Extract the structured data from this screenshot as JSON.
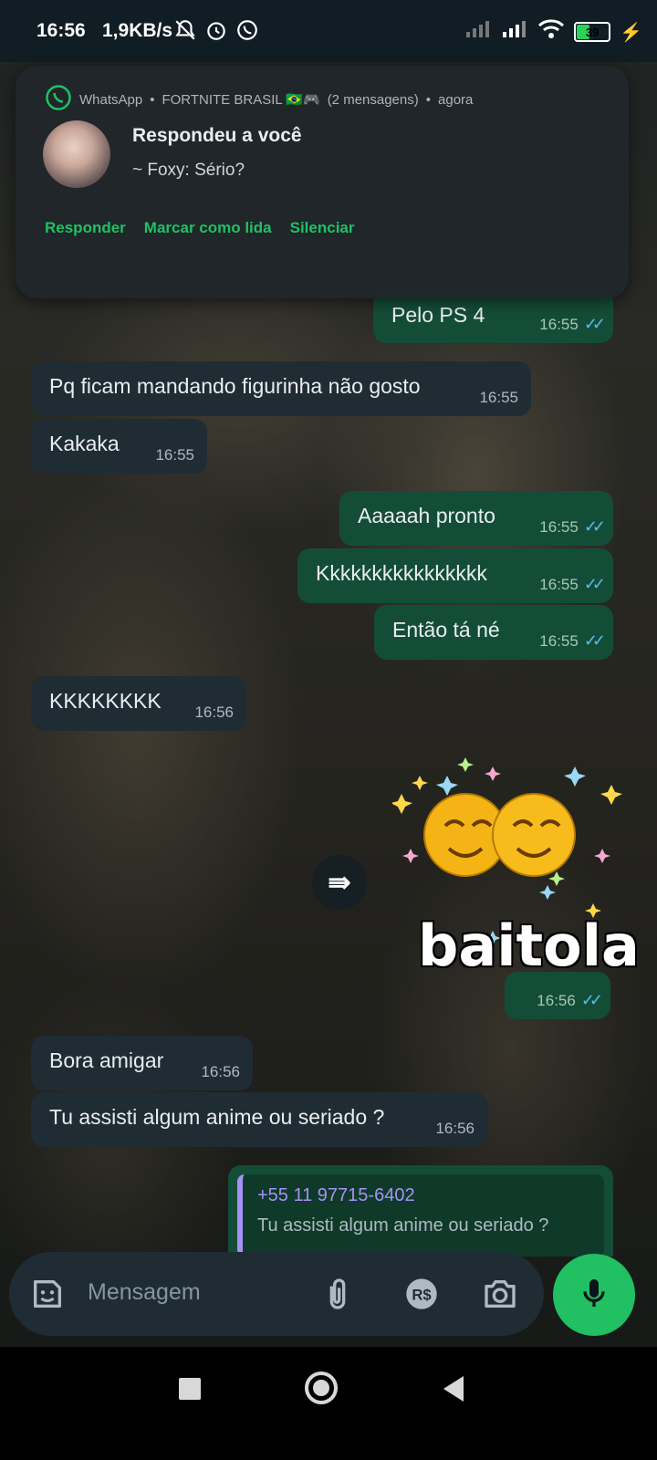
{
  "status_bar": {
    "time": "16:56",
    "speed": "1,9KB/s",
    "battery": "39"
  },
  "notification": {
    "app": "WhatsApp",
    "group": "FORTNITE BRASIL 🇧🇷🎮",
    "count": "(2 mensagens)",
    "when": "agora",
    "title": "Respondeu a você",
    "text": "~ Foxy: Sério?",
    "actions": [
      "Responder",
      "Marcar como lida",
      "Silenciar"
    ]
  },
  "messages": [
    {
      "dir": "out",
      "text": "Pelo PS 4",
      "time": "16:55"
    },
    {
      "dir": "in",
      "text": "Pq ficam mandando figurinha não gosto",
      "time": "16:55"
    },
    {
      "dir": "in",
      "text": "Kakaka",
      "time": "16:55"
    },
    {
      "dir": "out",
      "text": "Aaaaah pronto",
      "time": "16:55"
    },
    {
      "dir": "out",
      "text": "Kkkkkkkkkkkkkkkk",
      "time": "16:55"
    },
    {
      "dir": "out",
      "text": "Então tá né",
      "time": "16:55"
    },
    {
      "dir": "in",
      "text": "KKKKKKKK",
      "time": "16:56"
    },
    {
      "dir": "in",
      "text": "Bora amigar",
      "time": "16:56"
    },
    {
      "dir": "in",
      "text": "Tu assisti algum anime ou seriado ?",
      "time": "16:56"
    }
  ],
  "sticker": {
    "text": "baitola",
    "time": "16:56"
  },
  "quoted_reply": {
    "author": "+55 11 97715-6402",
    "text": "Tu assisti algum anime ou seriado ?"
  },
  "input": {
    "placeholder": "Mensagem"
  },
  "colors": {
    "accent": "#21c063",
    "outgoing_bubble": "#144d37",
    "incoming_bubble": "#1f2c33",
    "read_ticks": "#53bdeb"
  }
}
